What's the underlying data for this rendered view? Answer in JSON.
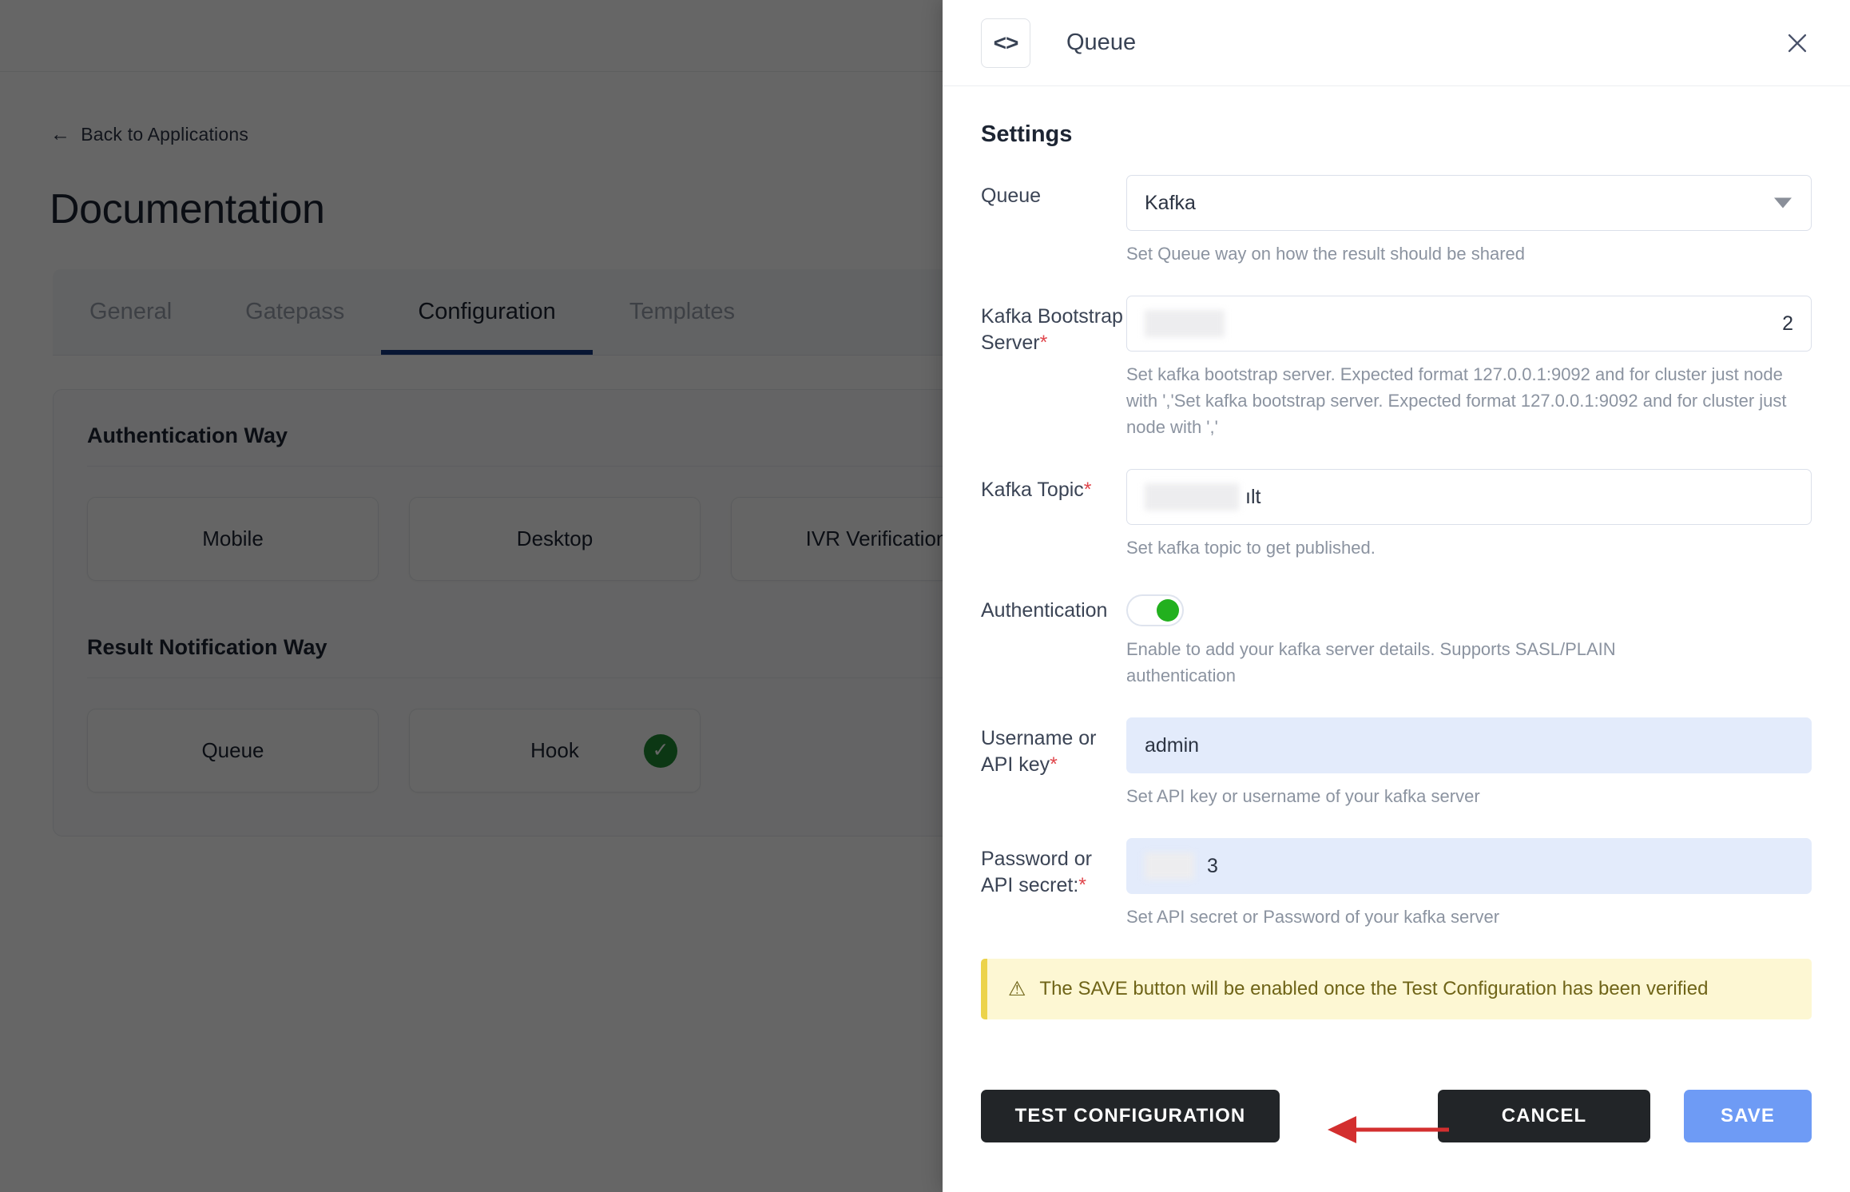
{
  "background": {
    "back_link": "Back to Applications",
    "back_icon": "arrow-left-icon",
    "page_title": "Documentation",
    "tabs": [
      {
        "label": "General",
        "active": false
      },
      {
        "label": "Gatepass",
        "active": false
      },
      {
        "label": "Configuration",
        "active": true
      },
      {
        "label": "Templates",
        "active": false
      }
    ],
    "sections": [
      {
        "title": "Authentication Way",
        "options": [
          {
            "label": "Mobile",
            "selected": false
          },
          {
            "label": "Desktop",
            "selected": false
          },
          {
            "label": "IVR Verification",
            "selected": false
          }
        ]
      },
      {
        "title": "Result Notification Way",
        "options": [
          {
            "label": "Queue",
            "selected": false
          },
          {
            "label": "Hook",
            "selected": true
          }
        ]
      }
    ]
  },
  "drawer": {
    "badge_icon": "code-brackets-icon",
    "badge_glyph": "<>",
    "title": "Queue",
    "close_icon": "close-icon",
    "settings_heading": "Settings",
    "fields": [
      {
        "label": "Queue",
        "required": false,
        "type": "select",
        "value": "Kafka",
        "hint": "Set Queue way on how the result should be shared"
      },
      {
        "label": "Kafka Bootstrap Server",
        "required": true,
        "type": "text-redacted",
        "value": "2",
        "hint": "Set kafka bootstrap server. Expected format 127.0.0.1:9092 and for cluster just node with ','Set kafka bootstrap server. Expected format 127.0.0.1:9092 and for cluster just node with ','"
      },
      {
        "label": "Kafka Topic",
        "required": true,
        "type": "text-redacted",
        "value": "ılt",
        "hint": "Set kafka topic to get published."
      },
      {
        "label": "Authentication",
        "required": false,
        "type": "toggle",
        "value": "on",
        "hint": "Enable to add your kafka server details. Supports SASL/PLAIN authentication"
      },
      {
        "label": "Username or API key",
        "required": true,
        "type": "text",
        "value": "admin",
        "hint": "Set API key or username of your kafka server"
      },
      {
        "label": "Password or API secret:",
        "required": true,
        "type": "text-redacted",
        "value": "3",
        "hint": "Set API secret or Password of your kafka server"
      }
    ],
    "alert": {
      "icon": "warning-triangle-icon",
      "text": "The SAVE button will be enabled once the Test Configuration has been verified"
    },
    "buttons": {
      "test": "TEST CONFIGURATION",
      "cancel": "CANCEL",
      "save": "SAVE"
    },
    "annotation": {
      "name": "red-arrow-pointing-to-test-configuration",
      "color": "#d32f2f"
    }
  },
  "colors": {
    "accent_blue": "#15387f",
    "save_blue": "#6e9bf5",
    "dark_button": "#222528",
    "toggle_green": "#22b01e",
    "check_green": "#1e8a32",
    "alert_bg": "#fdf7d3",
    "alert_border": "#ecd34b",
    "required_red": "#e0464c",
    "annotation_red": "#d32f2f"
  }
}
